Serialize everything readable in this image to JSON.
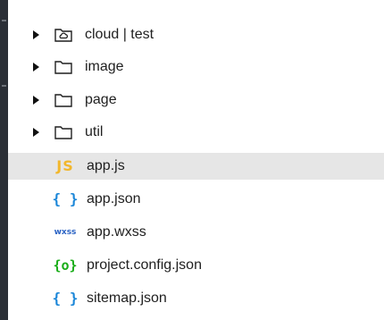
{
  "explorer": {
    "items": [
      {
        "type": "folder",
        "label": "cloud | test",
        "icon": "cloud-folder-icon"
      },
      {
        "type": "folder",
        "label": "image",
        "icon": "folder-icon"
      },
      {
        "type": "folder",
        "label": "page",
        "icon": "folder-icon"
      },
      {
        "type": "folder",
        "label": "util",
        "icon": "folder-icon"
      },
      {
        "type": "file",
        "label": "app.js",
        "icon_text": "JS",
        "icon": "js-file-icon"
      },
      {
        "type": "file",
        "label": "app.json",
        "icon_text": "{ }",
        "icon": "json-file-icon"
      },
      {
        "type": "file",
        "label": "app.wxss",
        "icon_text": "wxss",
        "icon": "wxss-file-icon"
      },
      {
        "type": "file",
        "label": "project.config.json",
        "icon_text": "{o}",
        "icon": "config-file-icon"
      },
      {
        "type": "file",
        "label": "sitemap.json",
        "icon_text": "{ }",
        "icon": "json-file-icon"
      }
    ]
  },
  "colors": {
    "js": "#f2b72c",
    "json": "#1a86d8",
    "wxss": "#2b63c4",
    "config": "#1aad19",
    "sidebar_strip": "#2b2f36",
    "selected_row": "#e6e6e6"
  }
}
